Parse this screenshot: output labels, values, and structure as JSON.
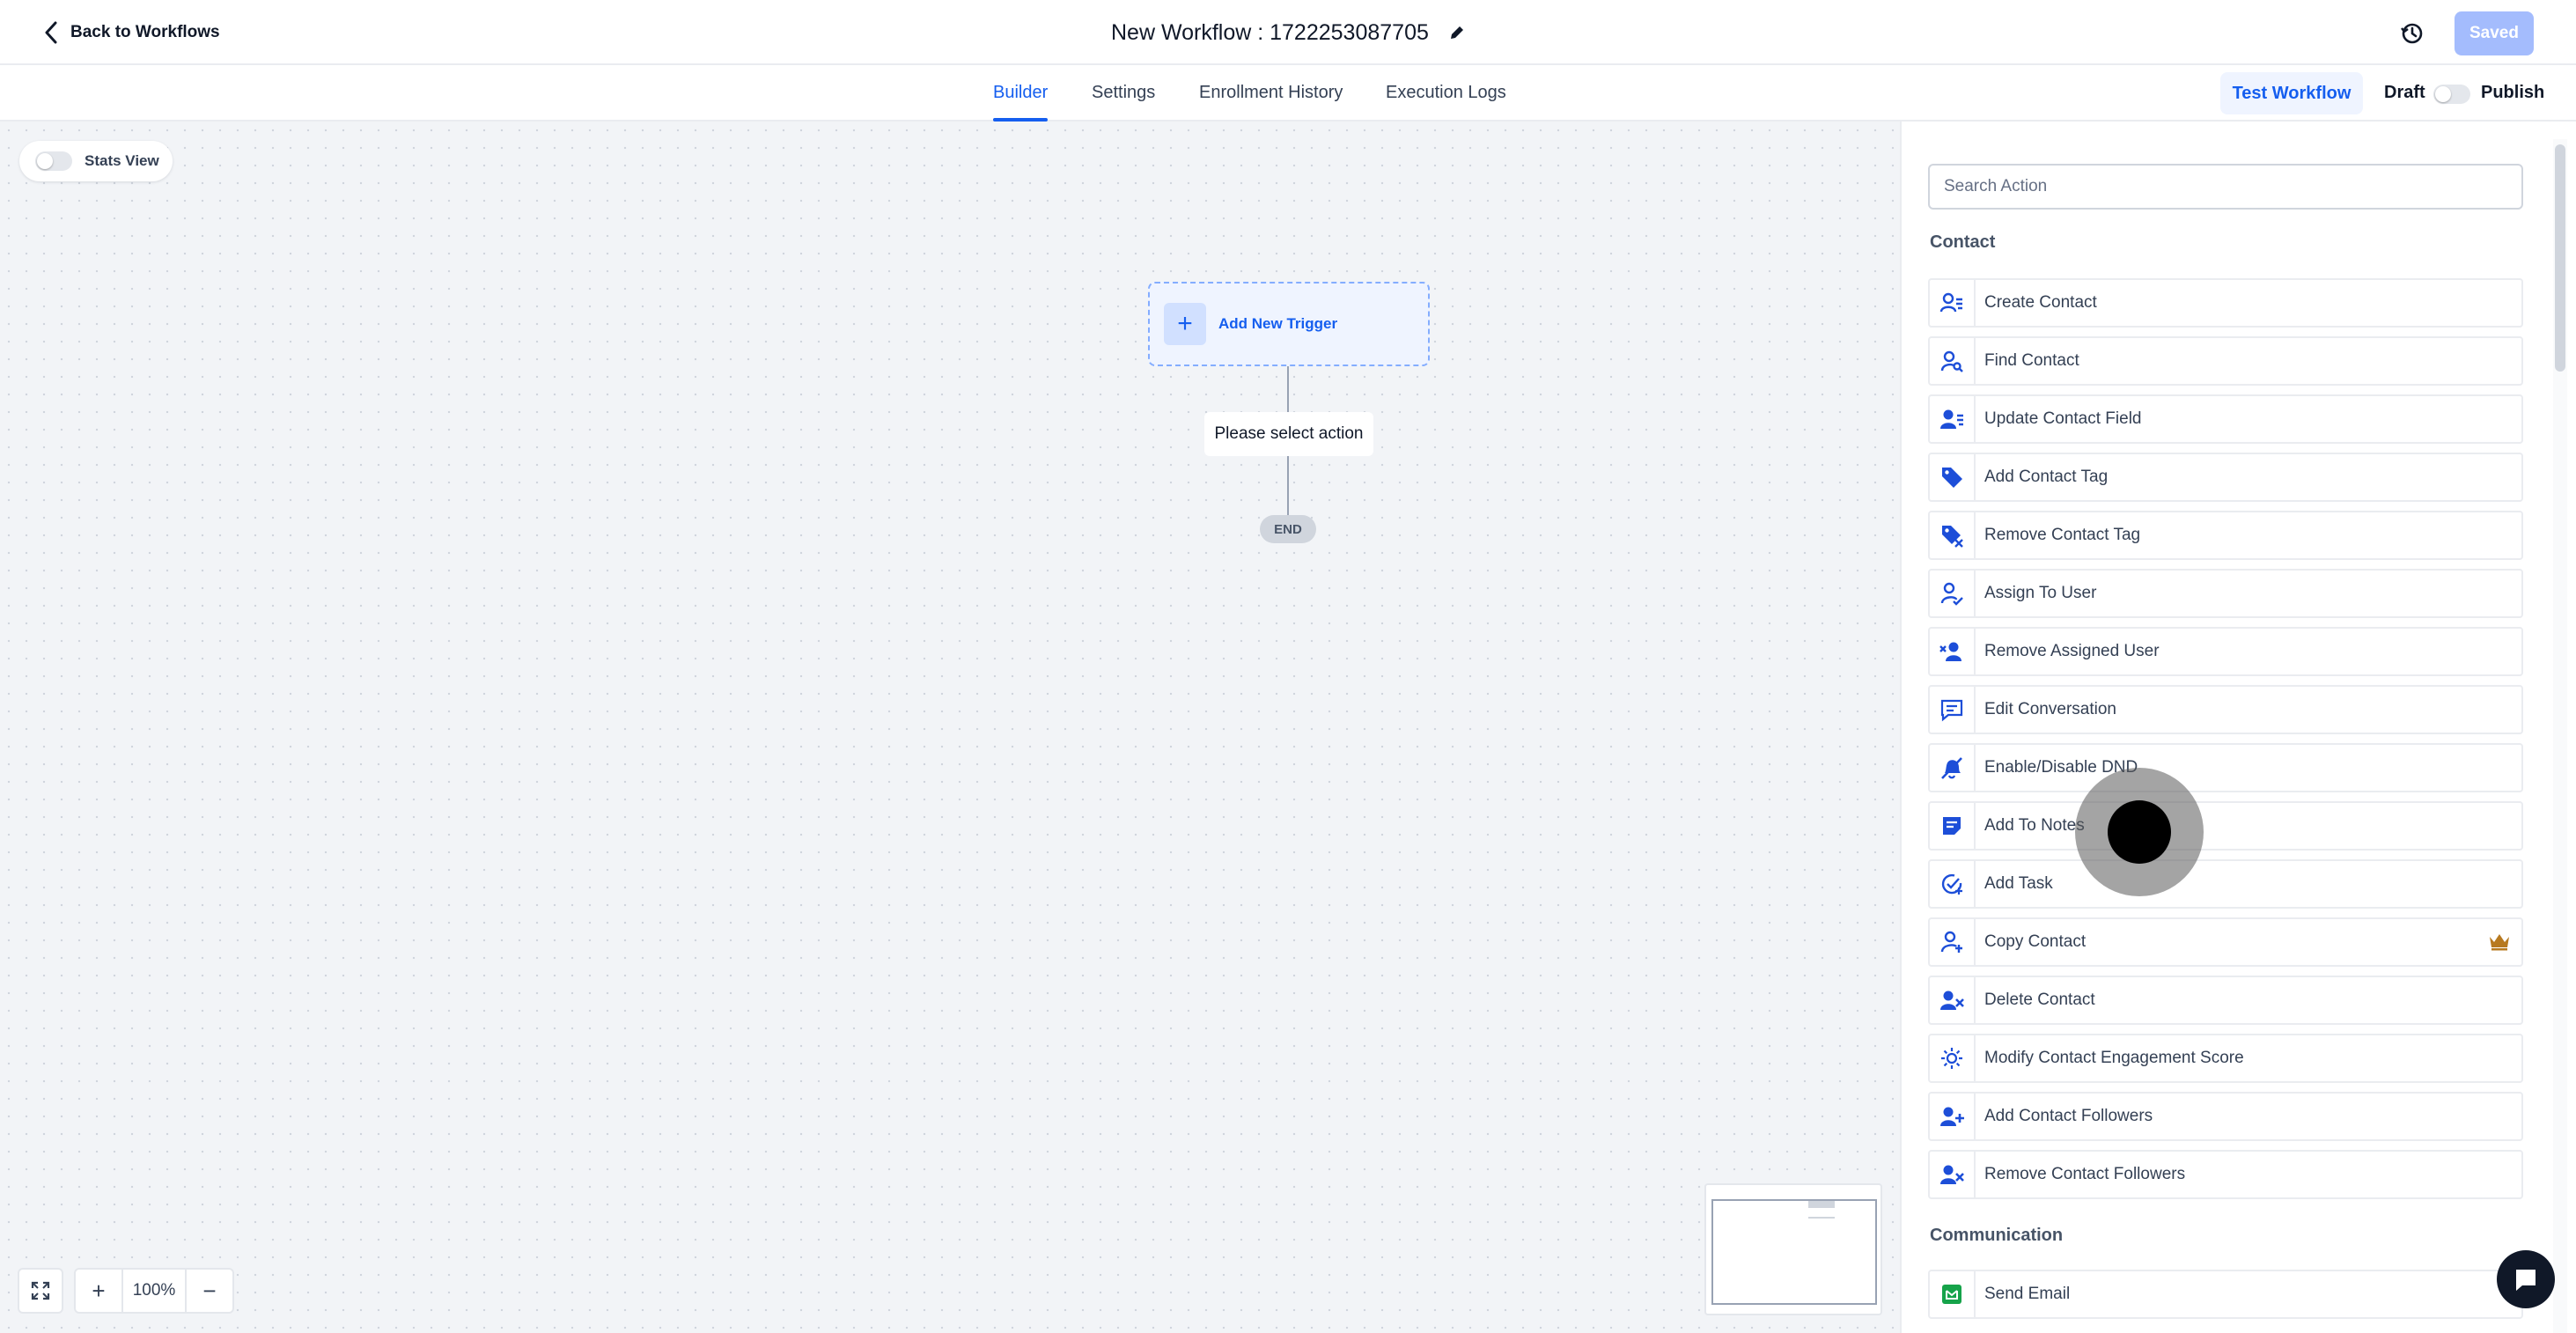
{
  "header": {
    "back_label": "Back to Workflows",
    "workflow_title": "New Workflow : 1722253087705",
    "saved_label": "Saved"
  },
  "nav": {
    "tabs": [
      {
        "label": "Builder",
        "active": true
      },
      {
        "label": "Settings",
        "active": false
      },
      {
        "label": "Enrollment History",
        "active": false
      },
      {
        "label": "Execution Logs",
        "active": false
      }
    ],
    "test_workflow_label": "Test Workflow",
    "draft_label": "Draft",
    "publish_label": "Publish",
    "published": false
  },
  "canvas": {
    "stats_view_label": "Stats View",
    "stats_view_on": false,
    "trigger_label": "Add New Trigger",
    "placeholder_label": "Please select action",
    "end_label": "END",
    "zoom_level": "100%"
  },
  "actions_panel": {
    "search_placeholder": "Search Action",
    "groups": [
      {
        "title": "Contact",
        "items": [
          {
            "label": "Create Contact",
            "icon": "user-list-icon"
          },
          {
            "label": "Find Contact",
            "icon": "user-search-icon"
          },
          {
            "label": "Update Contact Field",
            "icon": "user-lines-icon"
          },
          {
            "label": "Add Contact Tag",
            "icon": "tag-icon"
          },
          {
            "label": "Remove Contact Tag",
            "icon": "tag-remove-icon"
          },
          {
            "label": "Assign To User",
            "icon": "user-assign-icon"
          },
          {
            "label": "Remove Assigned User",
            "icon": "user-remove-icon"
          },
          {
            "label": "Edit Conversation",
            "icon": "message-icon"
          },
          {
            "label": "Enable/Disable DND",
            "icon": "bell-off-icon"
          },
          {
            "label": "Add To Notes",
            "icon": "note-icon"
          },
          {
            "label": "Add Task",
            "icon": "task-check-icon"
          },
          {
            "label": "Copy Contact",
            "icon": "user-copy-icon",
            "premium": true
          },
          {
            "label": "Delete Contact",
            "icon": "user-delete-icon"
          },
          {
            "label": "Modify Contact Engagement Score",
            "icon": "sun-icon"
          },
          {
            "label": "Add Contact Followers",
            "icon": "user-plus-icon"
          },
          {
            "label": "Remove Contact Followers",
            "icon": "user-x-icon"
          }
        ]
      },
      {
        "title": "Communication",
        "items": [
          {
            "label": "Send Email",
            "icon": "email-icon"
          }
        ]
      }
    ]
  },
  "colors": {
    "accent": "#155eef",
    "icon_blue": "#1d4ed8",
    "email_green": "#16a34a",
    "premium_gold": "#b7791f"
  }
}
